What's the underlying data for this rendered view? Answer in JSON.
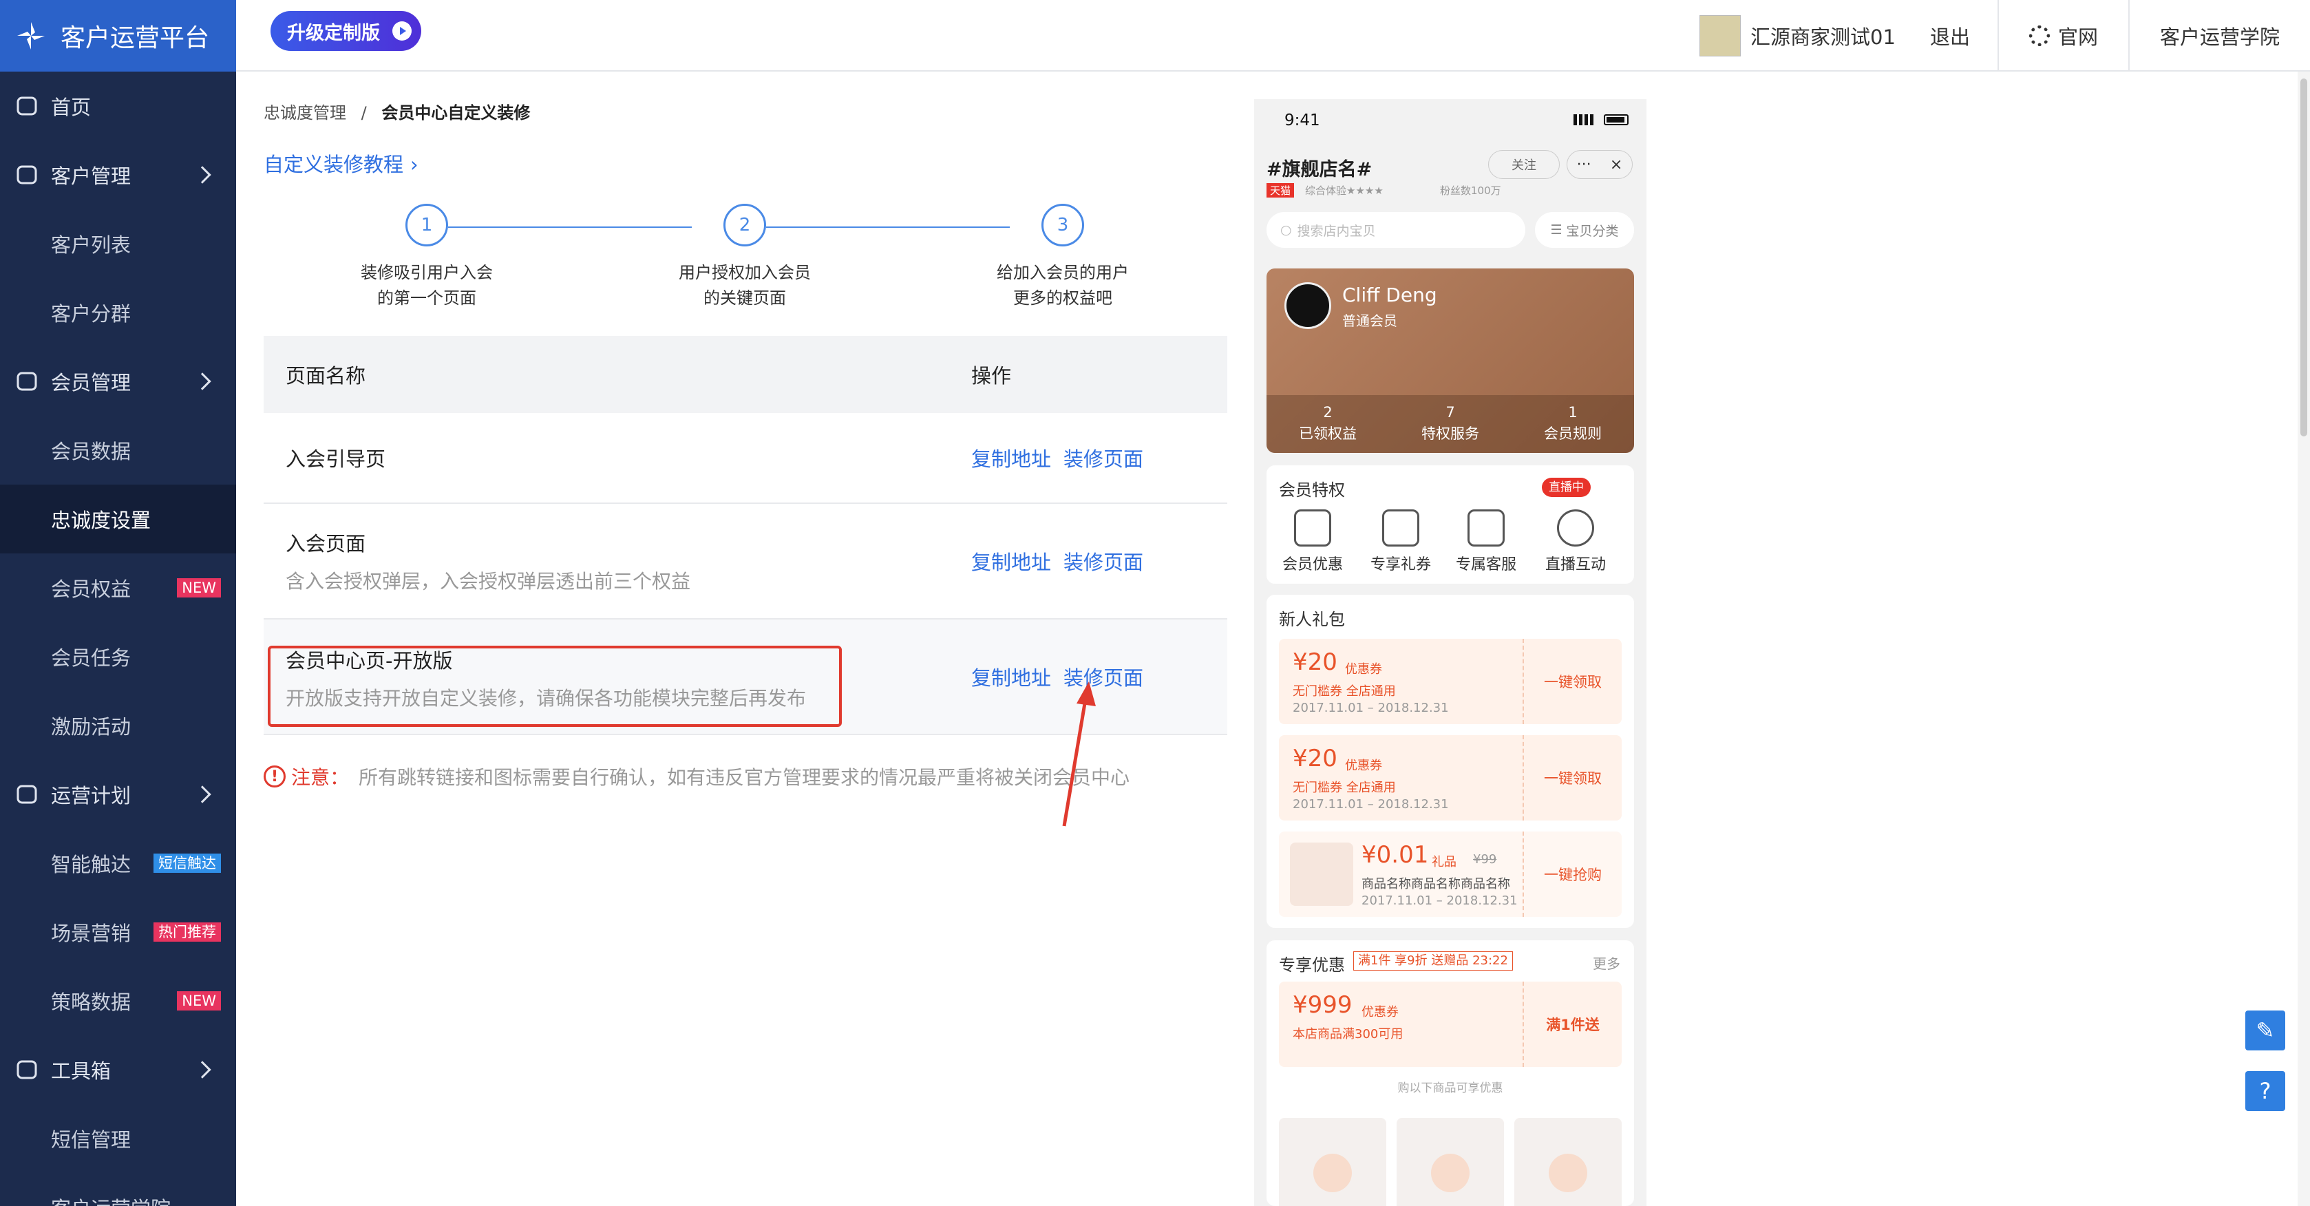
{
  "app": {
    "title": "客户运营平台",
    "upgrade_label": "升级定制版"
  },
  "topbar": {
    "account_name": "汇源商家测试01",
    "logout": "退出",
    "official_site": "官网",
    "academy": "客户运营学院"
  },
  "sidebar": {
    "items": [
      {
        "label": "首页",
        "icon": "home-icon",
        "type": "top"
      },
      {
        "label": "客户管理",
        "icon": "users-icon",
        "type": "top",
        "expandable": true
      },
      {
        "label": "客户列表",
        "type": "sub"
      },
      {
        "label": "客户分群",
        "type": "sub"
      },
      {
        "label": "会员管理",
        "icon": "star-badge-icon",
        "type": "top",
        "expandable": true
      },
      {
        "label": "会员数据",
        "type": "sub"
      },
      {
        "label": "忠诚度设置",
        "type": "sub",
        "active": true
      },
      {
        "label": "会员权益",
        "type": "sub",
        "badge": "NEW",
        "badge_color": "#e8345f"
      },
      {
        "label": "会员任务",
        "type": "sub"
      },
      {
        "label": "激励活动",
        "type": "sub"
      },
      {
        "label": "运营计划",
        "icon": "bulb-icon",
        "type": "top",
        "expandable": true
      },
      {
        "label": "智能触达",
        "type": "sub",
        "badge": "短信触达",
        "badge_color": "#2f8fe8"
      },
      {
        "label": "场景营销",
        "type": "sub",
        "badge": "热门推荐",
        "badge_color": "#e8345f"
      },
      {
        "label": "策略数据",
        "type": "sub",
        "badge": "NEW",
        "badge_color": "#e8345f"
      },
      {
        "label": "工具箱",
        "icon": "toolbox-icon",
        "type": "top",
        "expandable": true
      },
      {
        "label": "短信管理",
        "type": "sub"
      },
      {
        "label": "客户运营学院",
        "type": "sub"
      }
    ]
  },
  "breadcrumb": {
    "parent": "忠诚度管理",
    "separator": "/",
    "current": "会员中心自定义装修"
  },
  "tutorial_link": "自定义装修教程",
  "steps": [
    {
      "num": "1",
      "line1": "装修吸引用户入会",
      "line2": "的第一个页面"
    },
    {
      "num": "2",
      "line1": "用户授权加入会员",
      "line2": "的关键页面"
    },
    {
      "num": "3",
      "line1": "给加入会员的用户",
      "line2": "更多的权益吧"
    }
  ],
  "table": {
    "headers": {
      "name": "页面名称",
      "action": "操作"
    },
    "rows": [
      {
        "title": "入会引导页",
        "desc": "",
        "copy": "复制地址",
        "decorate": "装修页面"
      },
      {
        "title": "入会页面",
        "desc": "含入会授权弹层，入会授权弹层透出前三个权益",
        "copy": "复制地址",
        "decorate": "装修页面"
      },
      {
        "title": "会员中心页-开放版",
        "desc": "开放版支持开放自定义装修，请确保各功能模块完整后再发布",
        "copy": "复制地址",
        "decorate": "装修页面"
      }
    ]
  },
  "note": {
    "label": "注意：",
    "text": "所有跳转链接和图标需要自行确认，如有违反官方管理要求的情况最严重将被关闭会员中心"
  },
  "phone": {
    "time": "9:41",
    "store_name": "#旗舰店名#",
    "tmall": "天猫",
    "rating": "综合体验★★★★",
    "fans": "粉丝数100万",
    "follow": "关注",
    "search_placeholder": "搜索店内宝贝",
    "category": "宝贝分类",
    "member": {
      "name": "Cliff Deng",
      "level": "普通会员",
      "stats": [
        {
          "n": "2",
          "l": "已领权益"
        },
        {
          "n": "7",
          "l": "特权服务"
        },
        {
          "n": "1",
          "l": "会员规则"
        }
      ]
    },
    "privileges": {
      "title": "会员特权",
      "live_badge": "直播中",
      "items": [
        {
          "label": "会员优惠",
          "icon": "percent-icon"
        },
        {
          "label": "专享礼券",
          "icon": "ticket-icon"
        },
        {
          "label": "专属客服",
          "icon": "service-icon"
        },
        {
          "label": "直播互动",
          "icon": "live-icon"
        }
      ]
    },
    "gift": {
      "title": "新人礼包",
      "coupons": [
        {
          "amount": "¥20",
          "tag": "优惠券",
          "line1": "无门槛券 全店通用",
          "line2": "2017.11.01 – 2018.12.31",
          "action": "一键领取"
        },
        {
          "amount": "¥20",
          "tag": "优惠券",
          "line1": "无门槛券 全店通用",
          "line2": "2017.11.01 – 2018.12.31",
          "action": "一键领取"
        },
        {
          "amount": "¥0.01",
          "tag": "礼品",
          "old": "¥99",
          "line1": "商品名称商品名称商品名称",
          "line2": "2017.11.01 – 2018.12.31",
          "action": "一键抢购"
        }
      ]
    },
    "exclusive": {
      "title": "专享优惠",
      "tag": "满1件 享9折 送赠品 23:22",
      "more": "更多",
      "coupon": {
        "amount": "¥999",
        "tag": "优惠券",
        "line1": "本店商品满300可用",
        "action": "满1件送"
      },
      "hint": "购以下商品可享优惠"
    }
  },
  "colors": {
    "sidebar": "#1c2b4d",
    "logo_bg": "#2b62c9",
    "link": "#2f6fe0",
    "highlight": "#e03a2e",
    "accent": "#e8532a"
  }
}
